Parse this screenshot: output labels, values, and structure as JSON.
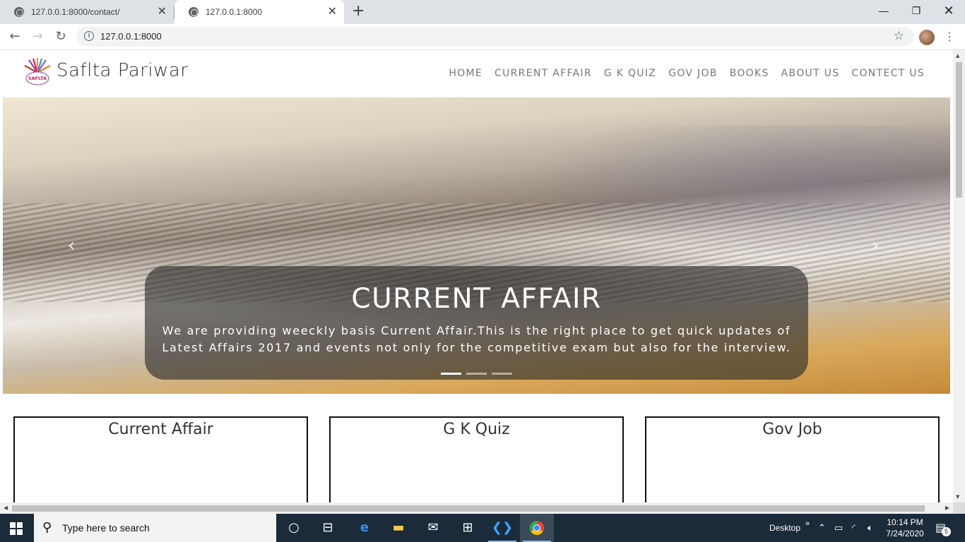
{
  "browser": {
    "tabs": [
      {
        "title": "127.0.0.1:8000/contact/",
        "active": false
      },
      {
        "title": "127.0.0.1:8000",
        "active": true
      }
    ],
    "new_tab": "+",
    "address": "127.0.0.1:8000"
  },
  "site": {
    "logo_text": "SAFLTA",
    "brand": "Saflta Pariwar",
    "nav": [
      "HOME",
      "CURRENT AFFAIR",
      "G K QUIZ",
      "GOV JOB",
      "BOOKS",
      "ABOUT US",
      "CONTECT US"
    ],
    "carousel": {
      "title": "CURRENT AFFAIR",
      "text": "We are providing weeckly basis Current Affair.This is the right place to get quick updates of Latest Affairs 2017 and events not only for the competitive exam but also for the interview.",
      "slides": 3,
      "active_slide": 1
    },
    "cards": [
      "Current Affair",
      "G K Quiz",
      "Gov Job"
    ]
  },
  "taskbar": {
    "search_placeholder": "Type here to search",
    "desktop_label": "Desktop",
    "time": "10:14 PM",
    "date": "7/24/2020",
    "notifications": "5"
  },
  "colors": {
    "taskbar": "#1c2b3a",
    "tabstrip": "#dee1e6",
    "nav_text": "#777777"
  }
}
